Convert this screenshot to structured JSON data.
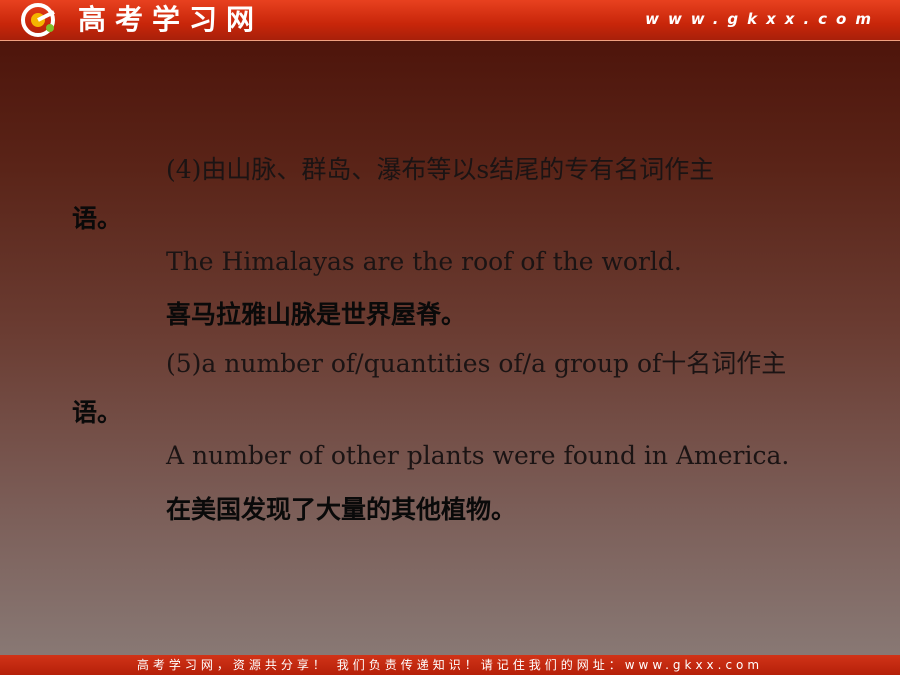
{
  "header": {
    "logo_text": "高考学习网",
    "site_url": "www.gkxx.com"
  },
  "slide": {
    "lines": [
      "(4)由山脉、群岛、瀑布等以s结尾的专有名词作主",
      "语。",
      "The Himalayas are the roof of the world.",
      "喜马拉雅山脉是世界屋脊。",
      "(5)a number of/quantities of/a group of十名词作主",
      "语。",
      "A number of other plants were found in America.",
      "在美国发现了大量的其他植物。"
    ]
  },
  "footer": {
    "text": "高考学习网，资源共分享！ 我们负责传递知识！请记住我们的网址：www.gkxx.com"
  },
  "colors": {
    "header_red": "#c8260a",
    "background_top": "#4a1007",
    "background_bottom": "#8a7c78"
  }
}
